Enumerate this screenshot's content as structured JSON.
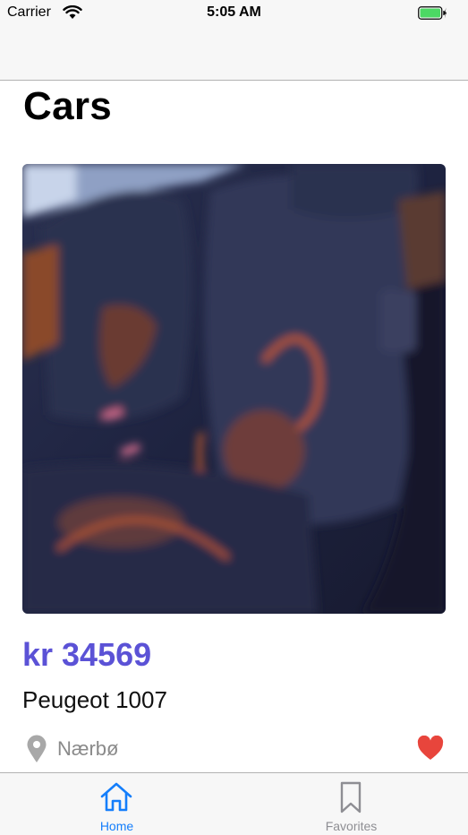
{
  "status_bar": {
    "carrier": "Carrier",
    "time": "5:05 AM"
  },
  "page": {
    "title": "Cars"
  },
  "listing": {
    "price": "kr 34569",
    "name": "Peugeot 1007",
    "location": "Nærbø",
    "is_favorite": true
  },
  "tab_bar": {
    "tabs": [
      {
        "label": "Home",
        "icon": "home-icon",
        "active": true
      },
      {
        "label": "Favorites",
        "icon": "bookmark-icon",
        "active": false
      }
    ]
  },
  "colors": {
    "accent": "#147efb",
    "price": "#5b52d6",
    "favorite": "#e8453c",
    "battery": "#4cd964"
  }
}
